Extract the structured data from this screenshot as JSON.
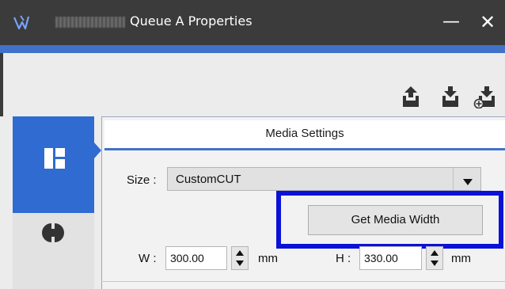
{
  "window": {
    "title_obscured": "LEF2-200",
    "title": "Queue A Properties",
    "minimize_glyph": "—",
    "close_glyph": "✕"
  },
  "toolbar": {
    "icons": [
      "export-icon",
      "import-icon",
      "import-add-icon"
    ]
  },
  "nav": {
    "items": [
      {
        "name": "media-settings-nav",
        "icon": "media-layout-icon",
        "selected": true
      },
      {
        "name": "cut-settings-nav",
        "icon": "half-circle-icon",
        "selected": false
      }
    ]
  },
  "panel": {
    "title": "Media Settings",
    "size_label": "Size :",
    "size_value": "CustomCUT",
    "get_media_width": "Get Media Width",
    "w_label": "W :",
    "w_value": "300.00",
    "w_unit": "mm",
    "h_label": "H :",
    "h_value": "330.00",
    "h_unit": "mm"
  },
  "colors": {
    "titlebar": "#3b3b3b",
    "accent": "#3f72c8",
    "nav_selected": "#2f6bd0",
    "highlight": "#0b12d8"
  }
}
